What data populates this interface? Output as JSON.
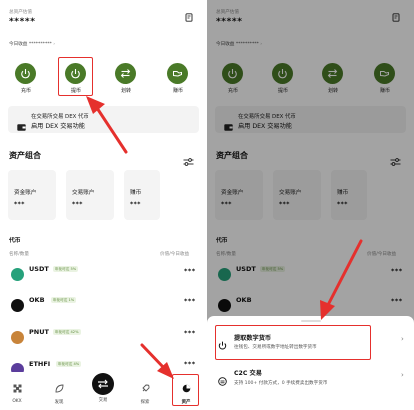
{
  "overview": {
    "total_label": "总资产估值",
    "total_value": "*****",
    "today_label": "今日收益",
    "today_value": "**********"
  },
  "actions": [
    {
      "label": "充币"
    },
    {
      "label": "提币"
    },
    {
      "label": "划转"
    },
    {
      "label": "赚币"
    }
  ],
  "dex_banner": {
    "line1": "在交易所交易 DEX 代币",
    "line2": "启用 DEX 交易功能"
  },
  "portfolio": {
    "title": "资产组合",
    "cards": [
      {
        "label": "资金账户",
        "value": "***"
      },
      {
        "label": "交易账户",
        "value": "***"
      },
      {
        "label": "赚币",
        "value": "***"
      }
    ]
  },
  "coins": {
    "title": "代币",
    "header_left": "名称/数量",
    "header_right": "价值/今日收益",
    "list": [
      {
        "name": "USDT",
        "tag": "年化可达 5%",
        "value": "***",
        "color": "#26a17b"
      },
      {
        "name": "OKB",
        "tag": "年化可达 1%",
        "value": "***",
        "color": "#111111"
      },
      {
        "name": "PNUT",
        "tag": "年化可达 42%",
        "value": "***",
        "color": "#c8843a"
      },
      {
        "name": "ETHFI",
        "tag": "年化可达 4%",
        "value": "***",
        "color": "#5b3d9c"
      }
    ]
  },
  "nav": {
    "items": [
      {
        "label": "OKX"
      },
      {
        "label": "发现"
      },
      {
        "label": "交易"
      },
      {
        "label": "探索"
      },
      {
        "label": "资产"
      }
    ]
  },
  "sheet": {
    "options": [
      {
        "title": "提取数字货币",
        "desc": "往钱包、交易所或数字地址转出数字货币"
      },
      {
        "title": "C2C 交易",
        "desc": "支持 100+ 付款方式，0 手续费卖出数字货币"
      }
    ]
  },
  "colors": {
    "accent": "#4a7a28",
    "highlight": "#e5302d"
  }
}
